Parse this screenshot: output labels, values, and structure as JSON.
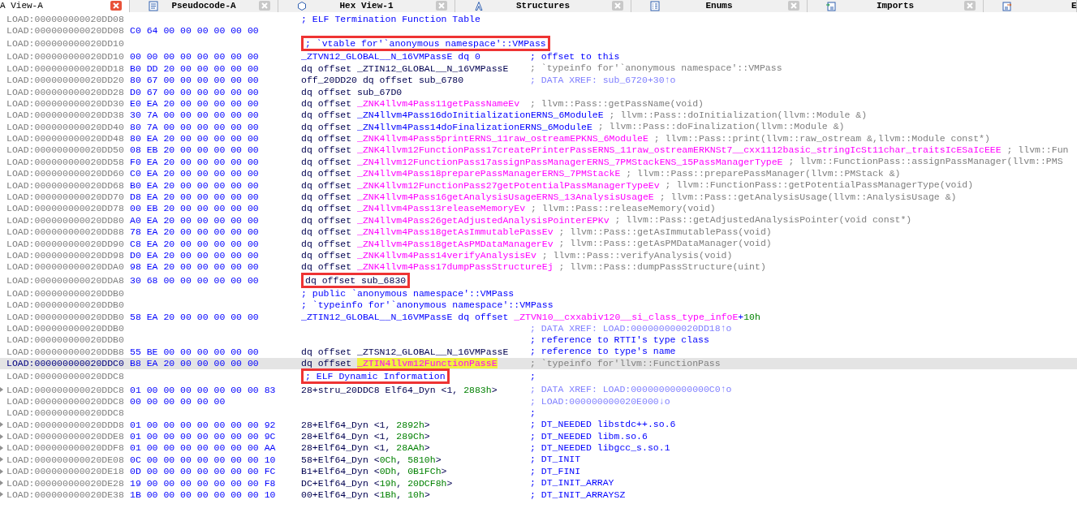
{
  "tabs": [
    {
      "label": "A View-A",
      "selected": true,
      "closable": true
    },
    {
      "label": "Pseudocode-A",
      "selected": false,
      "closable": true
    },
    {
      "label": "Hex View-1",
      "selected": false,
      "closable": true
    },
    {
      "label": "Structures",
      "selected": false,
      "closable": true
    },
    {
      "label": "Enums",
      "selected": false,
      "closable": true
    },
    {
      "label": "Imports",
      "selected": false,
      "closable": true
    },
    {
      "label": "E",
      "selected": false,
      "closable": false
    }
  ],
  "listing": {
    "rows": [
      {
        "address": "LOAD:000000000020DD08",
        "bytes": "",
        "code": [
          {
            "text": "; ELF Termination Function Table",
            "kind": "comment"
          }
        ],
        "selected": false,
        "expandable": false,
        "boxed": false
      },
      {
        "address": "LOAD:000000000020DD08",
        "bytes": "C0 64 00 00 00 00 00 00",
        "code": [],
        "selected": false,
        "expandable": false,
        "boxed": false
      },
      {
        "address": "LOAD:000000000020DD10",
        "bytes": "",
        "code": [
          {
            "text": "; `vtable for'`anonymous namespace'::VMPass",
            "kind": "comment"
          }
        ],
        "selected": false,
        "expandable": false,
        "boxed": true
      },
      {
        "address": "LOAD:000000000020DD10",
        "bytes": "00 00 00 00 00 00 00 00",
        "code": [
          {
            "text": "_ZTVN12_GLOBAL__N_16VMPassE dq 0",
            "kind": "label"
          }
        ],
        "comment": {
          "text": "; offset to this",
          "kind": "regular"
        },
        "selected": false,
        "expandable": false,
        "boxed": false
      },
      {
        "address": "LOAD:000000000020DD18",
        "bytes": "B0 DD 20 00 00 00 00 00",
        "code": [
          {
            "text": "dq offset _ZTIN12_GLOBAL__N_16VMPassE",
            "kind": "plain"
          }
        ],
        "comment": {
          "text": "; `typeinfo for'`anonymous namespace'::VMPass",
          "kind": "repeatable"
        },
        "selected": false,
        "expandable": false,
        "boxed": false
      },
      {
        "address": "LOAD:000000000020DD20",
        "bytes": "80 67 00 00 00 00 00 00",
        "code": [
          {
            "text": "off_20DD20 dq offset sub_6780",
            "kind": "plain"
          }
        ],
        "comment": {
          "text": "; DATA XREF: sub_6720+30↑o",
          "kind": "xref"
        },
        "selected": false,
        "expandable": false,
        "boxed": false
      },
      {
        "address": "LOAD:000000000020DD28",
        "bytes": "D0 67 00 00 00 00 00 00",
        "code": [
          {
            "text": "dq offset sub_67D0",
            "kind": "plain"
          }
        ],
        "selected": false,
        "expandable": false,
        "boxed": false
      },
      {
        "address": "LOAD:000000000020DD30",
        "bytes": "E0 EA 20 00 00 00 00 00",
        "code": [
          {
            "text": "dq offset ",
            "kind": "plain"
          },
          {
            "text": "_ZNK4llvm4Pass11getPassNameEv",
            "kind": "import"
          }
        ],
        "comment": {
          "text": "; llvm::Pass::getPassName(void)",
          "kind": "repeatable"
        },
        "selected": false,
        "expandable": false,
        "boxed": false
      },
      {
        "address": "LOAD:000000000020DD38",
        "bytes": "30 7A 00 00 00 00 00 00",
        "code": [
          {
            "text": "dq offset ",
            "kind": "plain"
          },
          {
            "text": "_ZN4llvm4Pass16doInitializationERNS_6ModuleE",
            "kind": "local"
          }
        ],
        "comment": {
          "text": "; llvm::Pass::doInitialization(llvm::Module &)",
          "kind": "repeatable"
        },
        "selected": false,
        "expandable": false,
        "boxed": false
      },
      {
        "address": "LOAD:000000000020DD40",
        "bytes": "80 7A 00 00 00 00 00 00",
        "code": [
          {
            "text": "dq offset ",
            "kind": "plain"
          },
          {
            "text": "_ZN4llvm4Pass14doFinalizationERNS_6ModuleE",
            "kind": "local"
          }
        ],
        "comment": {
          "text": "; llvm::Pass::doFinalization(llvm::Module &)",
          "kind": "repeatable"
        },
        "selected": false,
        "expandable": false,
        "boxed": false
      },
      {
        "address": "LOAD:000000000020DD48",
        "bytes": "80 EA 20 00 00 00 00 00",
        "code": [
          {
            "text": "dq offset ",
            "kind": "plain"
          },
          {
            "text": "_ZNK4llvm4Pass5printERNS_11raw_ostreamEPKNS_6ModuleE",
            "kind": "import"
          }
        ],
        "comment": {
          "text": "; llvm::Pass::print(llvm::raw_ostream &,llvm::Module const*)",
          "kind": "repeatable"
        },
        "selected": false,
        "expandable": false,
        "boxed": false
      },
      {
        "address": "LOAD:000000000020DD50",
        "bytes": "08 EB 20 00 00 00 00 00",
        "code": [
          {
            "text": "dq offset ",
            "kind": "plain"
          },
          {
            "text": "_ZNK4llvm12FunctionPass17createPrinterPassERNS_11raw_ostreamERKNSt7__cxx1112basic_stringIcSt11char_traitsIcESaIcEEE",
            "kind": "import"
          }
        ],
        "comment": {
          "text": "; llvm::Fun",
          "kind": "repeatable"
        },
        "selected": false,
        "expandable": false,
        "boxed": false
      },
      {
        "address": "LOAD:000000000020DD58",
        "bytes": "F0 EA 20 00 00 00 00 00",
        "code": [
          {
            "text": "dq offset ",
            "kind": "plain"
          },
          {
            "text": "_ZN4llvm12FunctionPass17assignPassManagerERNS_7PMStackENS_15PassManagerTypeE",
            "kind": "import"
          }
        ],
        "comment": {
          "text": "; llvm::FunctionPass::assignPassManager(llvm::PMS",
          "kind": "repeatable"
        },
        "selected": false,
        "expandable": false,
        "boxed": false
      },
      {
        "address": "LOAD:000000000020DD60",
        "bytes": "C0 EA 20 00 00 00 00 00",
        "code": [
          {
            "text": "dq offset ",
            "kind": "plain"
          },
          {
            "text": "_ZN4llvm4Pass18preparePassManagerERNS_7PMStackE",
            "kind": "import"
          }
        ],
        "comment": {
          "text": "; llvm::Pass::preparePassManager(llvm::PMStack &)",
          "kind": "repeatable"
        },
        "selected": false,
        "expandable": false,
        "boxed": false
      },
      {
        "address": "LOAD:000000000020DD68",
        "bytes": "B0 EA 20 00 00 00 00 00",
        "code": [
          {
            "text": "dq offset ",
            "kind": "plain"
          },
          {
            "text": "_ZNK4llvm12FunctionPass27getPotentialPassManagerTypeEv",
            "kind": "import"
          }
        ],
        "comment": {
          "text": "; llvm::FunctionPass::getPotentialPassManagerType(void)",
          "kind": "repeatable"
        },
        "selected": false,
        "expandable": false,
        "boxed": false
      },
      {
        "address": "LOAD:000000000020DD70",
        "bytes": "D8 EA 20 00 00 00 00 00",
        "code": [
          {
            "text": "dq offset ",
            "kind": "plain"
          },
          {
            "text": "_ZNK4llvm4Pass16getAnalysisUsageERNS_13AnalysisUsageE",
            "kind": "import"
          }
        ],
        "comment": {
          "text": "; llvm::Pass::getAnalysisUsage(llvm::AnalysisUsage &)",
          "kind": "repeatable"
        },
        "selected": false,
        "expandable": false,
        "boxed": false
      },
      {
        "address": "LOAD:000000000020DD78",
        "bytes": "00 EB 20 00 00 00 00 00",
        "code": [
          {
            "text": "dq offset ",
            "kind": "plain"
          },
          {
            "text": "_ZN4llvm4Pass13releaseMemoryEv",
            "kind": "import"
          }
        ],
        "comment": {
          "text": "; llvm::Pass::releaseMemory(void)",
          "kind": "repeatable"
        },
        "selected": false,
        "expandable": false,
        "boxed": false
      },
      {
        "address": "LOAD:000000000020DD80",
        "bytes": "A0 EA 20 00 00 00 00 00",
        "code": [
          {
            "text": "dq offset ",
            "kind": "plain"
          },
          {
            "text": "_ZN4llvm4Pass26getAdjustedAnalysisPointerEPKv",
            "kind": "import"
          }
        ],
        "comment": {
          "text": "; llvm::Pass::getAdjustedAnalysisPointer(void const*)",
          "kind": "repeatable"
        },
        "selected": false,
        "expandable": false,
        "boxed": false
      },
      {
        "address": "LOAD:000000000020DD88",
        "bytes": "78 EA 20 00 00 00 00 00",
        "code": [
          {
            "text": "dq offset ",
            "kind": "plain"
          },
          {
            "text": "_ZN4llvm4Pass18getAsImmutablePassEv",
            "kind": "import"
          }
        ],
        "comment": {
          "text": "; llvm::Pass::getAsImmutablePass(void)",
          "kind": "repeatable"
        },
        "selected": false,
        "expandable": false,
        "boxed": false
      },
      {
        "address": "LOAD:000000000020DD90",
        "bytes": "C8 EA 20 00 00 00 00 00",
        "code": [
          {
            "text": "dq offset ",
            "kind": "plain"
          },
          {
            "text": "_ZN4llvm4Pass18getAsPMDataManagerEv",
            "kind": "import"
          }
        ],
        "comment": {
          "text": "; llvm::Pass::getAsPMDataManager(void)",
          "kind": "repeatable"
        },
        "selected": false,
        "expandable": false,
        "boxed": false
      },
      {
        "address": "LOAD:000000000020DD98",
        "bytes": "D0 EA 20 00 00 00 00 00",
        "code": [
          {
            "text": "dq offset ",
            "kind": "plain"
          },
          {
            "text": "_ZNK4llvm4Pass14verifyAnalysisEv",
            "kind": "import"
          }
        ],
        "comment": {
          "text": "; llvm::Pass::verifyAnalysis(void)",
          "kind": "repeatable"
        },
        "selected": false,
        "expandable": false,
        "boxed": false
      },
      {
        "address": "LOAD:000000000020DDA0",
        "bytes": "98 EA 20 00 00 00 00 00",
        "code": [
          {
            "text": "dq offset ",
            "kind": "plain"
          },
          {
            "text": "_ZNK4llvm4Pass17dumpPassStructureEj",
            "kind": "import"
          }
        ],
        "comment": {
          "text": "; llvm::Pass::dumpPassStructure(uint)",
          "kind": "repeatable"
        },
        "selected": false,
        "expandable": false,
        "boxed": false
      },
      {
        "address": "LOAD:000000000020DDA8",
        "bytes": "30 68 00 00 00 00 00 00",
        "code": [
          {
            "text": "dq offset sub_6830",
            "kind": "plain"
          }
        ],
        "selected": false,
        "expandable": false,
        "boxed": true
      },
      {
        "address": "LOAD:000000000020DDB0",
        "bytes": "",
        "code": [
          {
            "text": "; public `anonymous namespace'::VMPass",
            "kind": "comment"
          }
        ],
        "selected": false,
        "expandable": false,
        "boxed": false
      },
      {
        "address": "LOAD:000000000020DDB0",
        "bytes": "",
        "code": [
          {
            "text": "; `typeinfo for'`anonymous namespace'::VMPass",
            "kind": "comment"
          }
        ],
        "selected": false,
        "expandable": false,
        "boxed": false
      },
      {
        "address": "LOAD:000000000020DDB0",
        "bytes": "58 EA 20 00 00 00 00 00",
        "code": [
          {
            "text": "_ZTIN12_GLOBAL__N_16VMPassE dq offset ",
            "kind": "label"
          },
          {
            "text": "_ZTVN10__cxxabiv120__si_class_type_infoE",
            "kind": "import"
          },
          {
            "text": "+",
            "kind": "label"
          },
          {
            "text": "10h",
            "kind": "number"
          }
        ],
        "selected": false,
        "expandable": false,
        "boxed": false
      },
      {
        "address": "LOAD:000000000020DDB0",
        "bytes": "",
        "code": [],
        "comment": {
          "text": "; DATA XREF: LOAD:000000000020DD18↑o",
          "kind": "xref"
        },
        "selected": false,
        "expandable": false,
        "boxed": false
      },
      {
        "address": "LOAD:000000000020DDB0",
        "bytes": "",
        "code": [],
        "comment": {
          "text": "; reference to RTTI's type class",
          "kind": "regular"
        },
        "selected": false,
        "expandable": false,
        "boxed": false
      },
      {
        "address": "LOAD:000000000020DDB8",
        "bytes": "55 BE 00 00 00 00 00 00",
        "code": [
          {
            "text": "dq offset _ZTSN12_GLOBAL__N_16VMPassE",
            "kind": "plain"
          }
        ],
        "comment": {
          "text": "; reference to type's name",
          "kind": "regular"
        },
        "selected": false,
        "expandable": false,
        "boxed": false
      },
      {
        "address": "LOAD:000000000020DDC0",
        "bytes": "B8 EA 20 00 00 00 00 00",
        "code": [
          {
            "text": "dq offset ",
            "kind": "plain"
          },
          {
            "text": "_ZTIN4llvm12FunctionPassE",
            "kind": "highlight"
          }
        ],
        "comment": {
          "text": "; `typeinfo for'llvm::FunctionPass",
          "kind": "repeatable"
        },
        "selected": true,
        "expandable": false,
        "boxed": false
      },
      {
        "address": "LOAD:000000000020DDC8",
        "bytes": "",
        "code": [
          {
            "text": "; ELF Dynamic Information",
            "kind": "comment"
          }
        ],
        "comment": {
          "text": ";",
          "kind": "regular"
        },
        "selected": false,
        "expandable": false,
        "boxed": true
      },
      {
        "address": "LOAD:000000000020DDC8",
        "bytes": "01 00 00 00 00 00 00 00 83",
        "code": [
          {
            "text": "28+stru_20DDC8 Elf64_Dyn <1, ",
            "kind": "plain"
          },
          {
            "text": "2883h",
            "kind": "number"
          },
          {
            "text": ">",
            "kind": "plain"
          }
        ],
        "comment": {
          "text": "; DATA XREF: LOAD:00000000000000C0↑o",
          "kind": "xref"
        },
        "selected": false,
        "expandable": true,
        "boxed": false
      },
      {
        "address": "LOAD:000000000020DDC8",
        "bytes": "00 00 00 00 00 00",
        "code": [],
        "comment": {
          "text": "; LOAD:000000000020E000↓o",
          "kind": "xref"
        },
        "selected": false,
        "expandable": false,
        "boxed": false
      },
      {
        "address": "LOAD:000000000020DDC8",
        "bytes": "",
        "code": [],
        "comment": {
          "text": ";",
          "kind": "regular"
        },
        "selected": false,
        "expandable": false,
        "boxed": false
      },
      {
        "address": "LOAD:000000000020DDD8",
        "bytes": "01 00 00 00 00 00 00 00 92",
        "code": [
          {
            "text": "28+Elf64_Dyn <1, ",
            "kind": "plain"
          },
          {
            "text": "2892h",
            "kind": "number"
          },
          {
            "text": ">",
            "kind": "plain"
          }
        ],
        "comment": {
          "text": "; DT_NEEDED libstdc++.so.6",
          "kind": "regular"
        },
        "selected": false,
        "expandable": true,
        "boxed": false
      },
      {
        "address": "LOAD:000000000020DDE8",
        "bytes": "01 00 00 00 00 00 00 00 9C",
        "code": [
          {
            "text": "28+Elf64_Dyn <1, ",
            "kind": "plain"
          },
          {
            "text": "289Ch",
            "kind": "number"
          },
          {
            "text": ">",
            "kind": "plain"
          }
        ],
        "comment": {
          "text": "; DT_NEEDED libm.so.6",
          "kind": "regular"
        },
        "selected": false,
        "expandable": true,
        "boxed": false
      },
      {
        "address": "LOAD:000000000020DDF8",
        "bytes": "01 00 00 00 00 00 00 00 AA",
        "code": [
          {
            "text": "28+Elf64_Dyn <1, ",
            "kind": "plain"
          },
          {
            "text": "28AAh",
            "kind": "number"
          },
          {
            "text": ">",
            "kind": "plain"
          }
        ],
        "comment": {
          "text": "; DT_NEEDED libgcc_s.so.1",
          "kind": "regular"
        },
        "selected": false,
        "expandable": true,
        "boxed": false
      },
      {
        "address": "LOAD:000000000020DE08",
        "bytes": "0C 00 00 00 00 00 00 00 10",
        "code": [
          {
            "text": "58+Elf64_Dyn <",
            "kind": "plain"
          },
          {
            "text": "0Ch",
            "kind": "number"
          },
          {
            "text": ", ",
            "kind": "plain"
          },
          {
            "text": "5810h",
            "kind": "number"
          },
          {
            "text": ">",
            "kind": "plain"
          }
        ],
        "comment": {
          "text": "; DT_INIT",
          "kind": "regular"
        },
        "selected": false,
        "expandable": true,
        "boxed": false
      },
      {
        "address": "LOAD:000000000020DE18",
        "bytes": "0D 00 00 00 00 00 00 00 FC",
        "code": [
          {
            "text": "B1+Elf64_Dyn <",
            "kind": "plain"
          },
          {
            "text": "0Dh",
            "kind": "number"
          },
          {
            "text": ", ",
            "kind": "plain"
          },
          {
            "text": "0B1FCh",
            "kind": "number"
          },
          {
            "text": ">",
            "kind": "plain"
          }
        ],
        "comment": {
          "text": "; DT_FINI",
          "kind": "regular"
        },
        "selected": false,
        "expandable": true,
        "boxed": false
      },
      {
        "address": "LOAD:000000000020DE28",
        "bytes": "19 00 00 00 00 00 00 00 F8",
        "code": [
          {
            "text": "DC+Elf64_Dyn <",
            "kind": "plain"
          },
          {
            "text": "19h",
            "kind": "number"
          },
          {
            "text": ", ",
            "kind": "plain"
          },
          {
            "text": "20DCF8h",
            "kind": "number"
          },
          {
            "text": ">",
            "kind": "plain"
          }
        ],
        "comment": {
          "text": "; DT_INIT_ARRAY",
          "kind": "regular"
        },
        "selected": false,
        "expandable": true,
        "boxed": false
      },
      {
        "address": "LOAD:000000000020DE38",
        "bytes": "1B 00 00 00 00 00 00 00 10",
        "code": [
          {
            "text": "00+Elf64_Dyn <",
            "kind": "plain"
          },
          {
            "text": "1Bh",
            "kind": "number"
          },
          {
            "text": ", ",
            "kind": "plain"
          },
          {
            "text": "10h",
            "kind": "number"
          },
          {
            "text": ">",
            "kind": "plain"
          }
        ],
        "comment": {
          "text": "; DT_INIT_ARRAYSZ",
          "kind": "regular"
        },
        "selected": false,
        "expandable": true,
        "boxed": false
      }
    ]
  }
}
